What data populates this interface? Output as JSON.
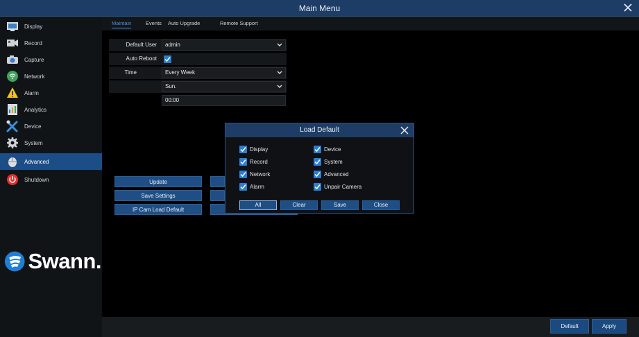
{
  "window": {
    "title": "Main Menu"
  },
  "sidebar": {
    "items": [
      {
        "label": "Display",
        "icon": "display-icon"
      },
      {
        "label": "Record",
        "icon": "record-icon"
      },
      {
        "label": "Capture",
        "icon": "capture-icon"
      },
      {
        "label": "Network",
        "icon": "network-icon"
      },
      {
        "label": "Alarm",
        "icon": "alarm-icon"
      },
      {
        "label": "Analytics",
        "icon": "analytics-icon"
      },
      {
        "label": "Device",
        "icon": "device-icon"
      },
      {
        "label": "System",
        "icon": "system-icon"
      },
      {
        "label": "Advanced",
        "icon": "advanced-icon"
      },
      {
        "label": "Shutdown",
        "icon": "shutdown-icon"
      }
    ],
    "active": "Advanced",
    "logo_text": "Swann."
  },
  "tabs": [
    {
      "label": "Maintain"
    },
    {
      "label": "Events"
    },
    {
      "label": "Auto Upgrade"
    },
    {
      "label": "Remote Support"
    }
  ],
  "form": {
    "default_user_label": "Default User",
    "default_user_value": "admin",
    "auto_reboot_label": "Auto Reboot",
    "time_label": "Time",
    "time_value": "Every Week",
    "day_value": "Sun.",
    "clock_value": "00:00"
  },
  "buttons": {
    "update": "Update",
    "save_settings": "Save Settings",
    "ipcam_load_default": "IP Cam Load Default"
  },
  "dialog": {
    "title": "Load Default",
    "options_left": [
      "Display",
      "Record",
      "Network",
      "Alarm"
    ],
    "options_right": [
      "Device",
      "System",
      "Advanced",
      "Unpair Camera"
    ],
    "buttons": {
      "all": "All",
      "clear": "Clear",
      "save": "Save",
      "close": "Close"
    }
  },
  "footer": {
    "default": "Default",
    "apply": "Apply"
  },
  "colors": {
    "accent": "#2a7fd4",
    "titlebar": "#1e3d66",
    "active_nav": "#1d4d86"
  }
}
